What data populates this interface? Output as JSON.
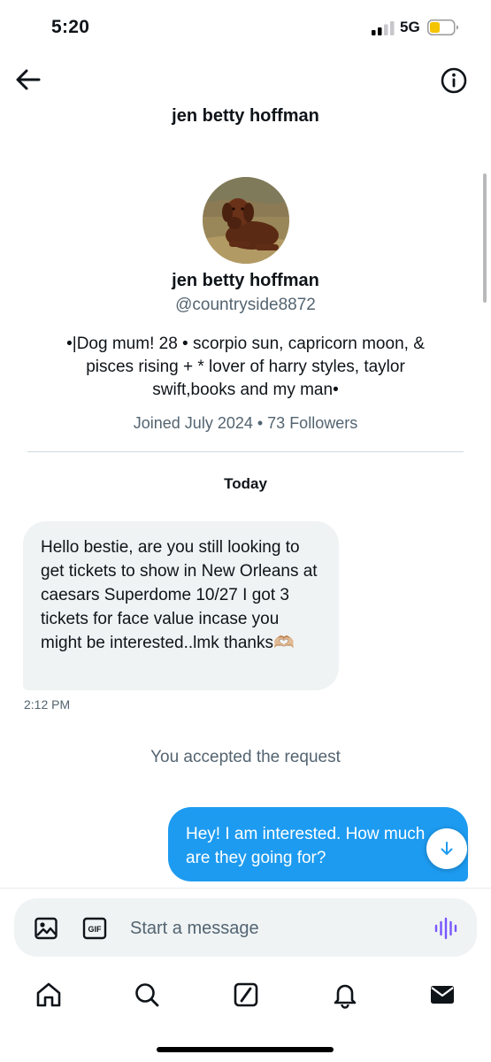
{
  "status_bar": {
    "time": "5:20",
    "network": "5G",
    "signal_icon": "signal-bars-icon",
    "battery_icon": "battery-icon",
    "battery_color": "#f5c400"
  },
  "header": {
    "title": "jen betty hoffman",
    "back_icon": "arrow-left-icon",
    "info_icon": "info-icon"
  },
  "profile": {
    "avatar_icon": "dog-avatar",
    "name": "jen betty hoffman",
    "handle": "@countryside8872",
    "bio": "•|Dog mum! 28 • scorpio sun, capricorn moon, & pisces rising + * lover of harry styles, taylor swift,books and my man•",
    "meta": "Joined July 2024 • 73 Followers"
  },
  "conversation": {
    "day_label": "Today",
    "incoming": {
      "text": "Hello bestie, are you still looking to get tickets to show in New Orleans at caesars Superdome 10/27 I got 3 tickets for face value incase you might be interested..lmk thanks🫶🏼",
      "time": "2:12 PM"
    },
    "system": "You accepted the request",
    "outgoing": {
      "text_line1": "Hey! I am interested. How much",
      "text_line2": "are they going for?"
    }
  },
  "composer": {
    "placeholder": "Start a message",
    "image_icon": "image-icon",
    "gif_label": "GIF",
    "voice_icon": "voice-waveform-icon",
    "accent_color": "#7856ff"
  },
  "tabs": [
    "home-icon",
    "search-icon",
    "grok-icon",
    "bell-icon",
    "mail-icon"
  ],
  "colors": {
    "accent": "#1d9bf0",
    "secondary_text": "#536471",
    "bubble_in": "#eff3f4"
  }
}
